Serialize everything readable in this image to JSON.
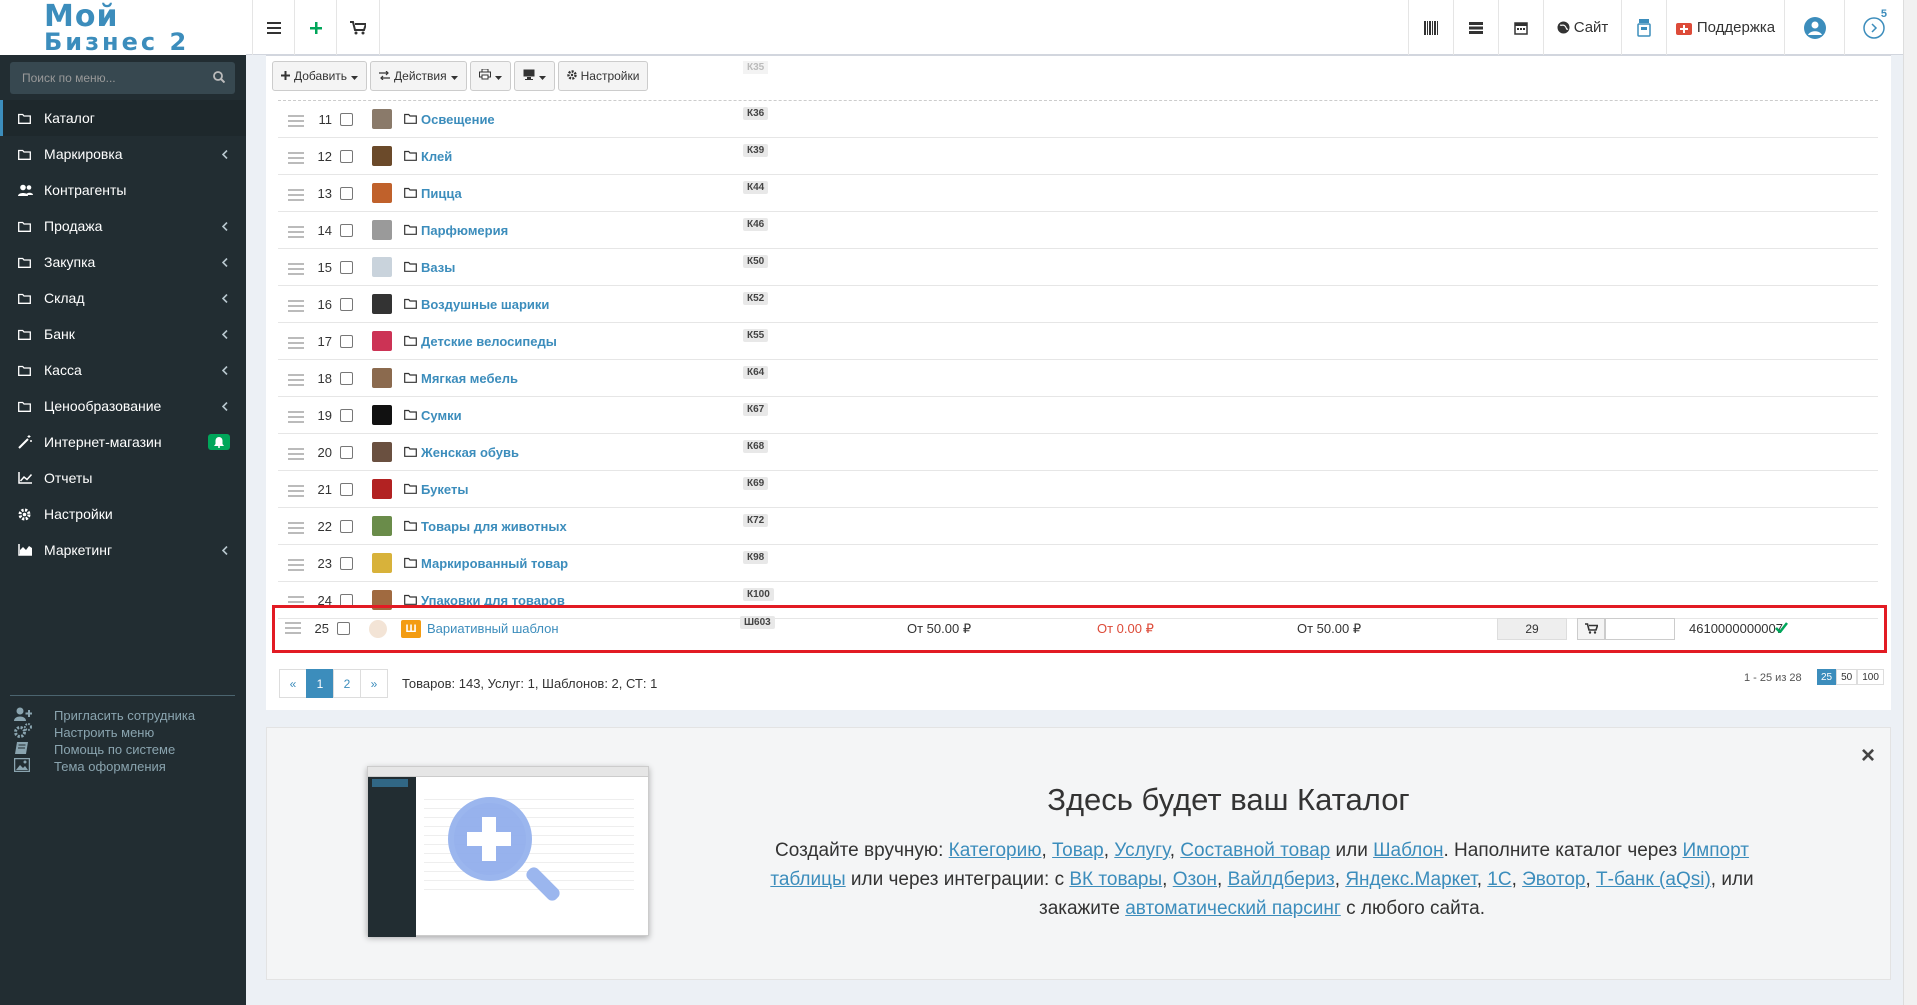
{
  "header": {
    "logo_line1": "Мой",
    "logo_line2": "Бизнес 2",
    "site_label": "Сайт",
    "support_label": "Поддержка",
    "badge_count": "5"
  },
  "sidebar": {
    "search_placeholder": "Поиск по меню...",
    "items": [
      {
        "label": "Каталог",
        "icon": "folder-icon",
        "active": true
      },
      {
        "label": "Маркировка",
        "icon": "folder-icon"
      },
      {
        "label": "Контрагенты",
        "icon": "users-icon"
      },
      {
        "label": "Продажа",
        "icon": "folder-icon"
      },
      {
        "label": "Закупка",
        "icon": "folder-icon"
      },
      {
        "label": "Склад",
        "icon": "folder-icon"
      },
      {
        "label": "Банк",
        "icon": "folder-icon"
      },
      {
        "label": "Касса",
        "icon": "folder-icon"
      },
      {
        "label": "Ценообразование",
        "icon": "folder-icon"
      },
      {
        "label": "Интернет-магазин",
        "icon": "magic-wand-icon"
      },
      {
        "label": "Отчеты",
        "icon": "chart-line-icon"
      },
      {
        "label": "Настройки",
        "icon": "gear-icon"
      },
      {
        "label": "Маркетинг",
        "icon": "chart-area-icon"
      }
    ],
    "links": [
      {
        "label": "Пригласить сотрудника",
        "icon": "user-plus-icon"
      },
      {
        "label": "Настроить меню",
        "icon": "gears-icon"
      },
      {
        "label": "Помощь по системе",
        "icon": "book-icon"
      },
      {
        "label": "Тема оформления",
        "icon": "image-icon"
      }
    ]
  },
  "toolbar": {
    "add_label": "Добавить",
    "actions_label": "Действия",
    "settings_label": "Настройки"
  },
  "top_faded_code": "К35",
  "rows": [
    {
      "num": "11",
      "name": "Освещение",
      "code": "К36",
      "thumb_color": "#8a7a6a"
    },
    {
      "num": "12",
      "name": "Клей",
      "code": "К39",
      "thumb_color": "#6b4a2a"
    },
    {
      "num": "13",
      "name": "Пицца",
      "code": "К44",
      "thumb_color": "#c0612b"
    },
    {
      "num": "14",
      "name": "Парфюмерия",
      "code": "К46",
      "thumb_color": "#9a9a9a"
    },
    {
      "num": "15",
      "name": "Вазы",
      "code": "К50",
      "thumb_color": "#c9d3dc"
    },
    {
      "num": "16",
      "name": "Воздушные шарики",
      "code": "К52",
      "thumb_color": "#333333"
    },
    {
      "num": "17",
      "name": "Детские велосипеды",
      "code": "К55",
      "thumb_color": "#cc3355"
    },
    {
      "num": "18",
      "name": "Мягкая мебель",
      "code": "К64",
      "thumb_color": "#8b6a4e"
    },
    {
      "num": "19",
      "name": "Сумки",
      "code": "К67",
      "thumb_color": "#111111"
    },
    {
      "num": "20",
      "name": "Женская обувь",
      "code": "К68",
      "thumb_color": "#6a5040"
    },
    {
      "num": "21",
      "name": "Букеты",
      "code": "К69",
      "thumb_color": "#b22222"
    },
    {
      "num": "22",
      "name": "Товары для животных",
      "code": "К72",
      "thumb_color": "#6a8c4a"
    },
    {
      "num": "23",
      "name": "Маркированный товар",
      "code": "К98",
      "thumb_color": "#d8b23a"
    },
    {
      "num": "24",
      "name": "Упаковки для товаров",
      "code": "К100",
      "thumb_color": "#a06a40"
    }
  ],
  "highlight_row": {
    "num": "25",
    "badge": "Ш",
    "name": "Вариативный шаблон",
    "code": "Ш603",
    "price_buy": "От 50.00 ₽",
    "price_zero": "От 0.00 ₽",
    "price_sell": "От 50.00 ₽",
    "qty": "29",
    "barcode": "4610000000007"
  },
  "pagination": {
    "prev": "«",
    "pages": [
      "1",
      "2"
    ],
    "next": "»",
    "summary": "Товаров: 143, Услуг: 1, Шаблонов: 2, СТ: 1",
    "range": "1 - 25 из 28",
    "sizes": [
      "25",
      "50",
      "100"
    ]
  },
  "info": {
    "title": "Здесь будет ваш Каталог",
    "close": "×",
    "t1": "Создайте вручную: ",
    "l_category": "Категорию",
    "l_goods": "Товар",
    "l_service": "Услугу",
    "l_composite": "Составной товар",
    "t_or": " или ",
    "l_template": "Шаблон",
    "t2": ". Наполните каталог через ",
    "l_import": "Импорт таблицы",
    "t3": " или через интеграции: с ",
    "l_vk": "ВК товары",
    "l_ozon": "Озон",
    "l_wb": "Вайлдбериз",
    "l_ym": "Яндекс.Маркет",
    "l_1c": "1С",
    "l_evotor": "Эвотор",
    "l_tbank": "Т-банк (aQsi)",
    "t4": ", или закажите ",
    "l_parsing": "автоматический парсинг",
    "t5": " с любого сайта."
  }
}
